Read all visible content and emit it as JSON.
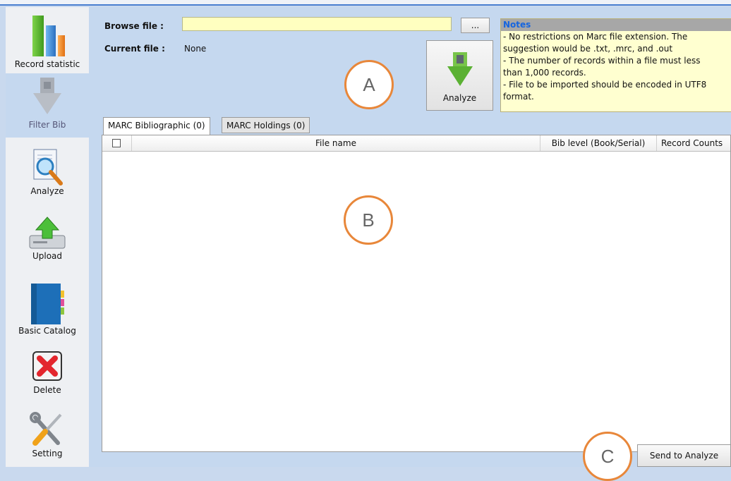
{
  "sidebar": {
    "items": [
      {
        "label": "Record statistic",
        "icon": "bar-chart-icon"
      },
      {
        "label": "Filter Bib",
        "icon": "filter-arrow-icon"
      },
      {
        "label": "Analyze",
        "icon": "magnifier-document-icon"
      },
      {
        "label": "Upload",
        "icon": "upload-drive-icon"
      },
      {
        "label": "Basic Catalog",
        "icon": "catalog-book-icon"
      },
      {
        "label": "Delete",
        "icon": "red-x-icon"
      },
      {
        "label": "Setting",
        "icon": "wrench-screwdriver-icon"
      }
    ]
  },
  "form": {
    "browse_label": "Browse file :",
    "browse_value": "",
    "browse_button": "...",
    "current_label": "Current file :",
    "current_value": "None",
    "analyze_button": "Analyze"
  },
  "notes": {
    "title": "Notes",
    "lines": [
      "- No restrictions on Marc file extension. The",
      "suggestion would be .txt, .mrc, and .out",
      "- The number of records within a file must less",
      "than 1,000 records.",
      "- File to be imported should be encoded in UTF8",
      "format."
    ]
  },
  "tabs": [
    {
      "label": "MARC Bibliographic (0)",
      "active": true
    },
    {
      "label": "MARC Holdings (0)",
      "active": false
    }
  ],
  "table": {
    "columns": [
      "File name",
      "Bib level (Book/Serial)",
      "Record Counts"
    ],
    "rows": []
  },
  "callouts": {
    "a": "A",
    "b": "B",
    "c": "C"
  },
  "footer": {
    "send_button": "Send to Analyze"
  },
  "colors": {
    "accent_orange": "#e8873a",
    "notes_bg": "#ffffd0",
    "notes_title": "#1565e0",
    "panel_bg": "#c5d8ef"
  }
}
